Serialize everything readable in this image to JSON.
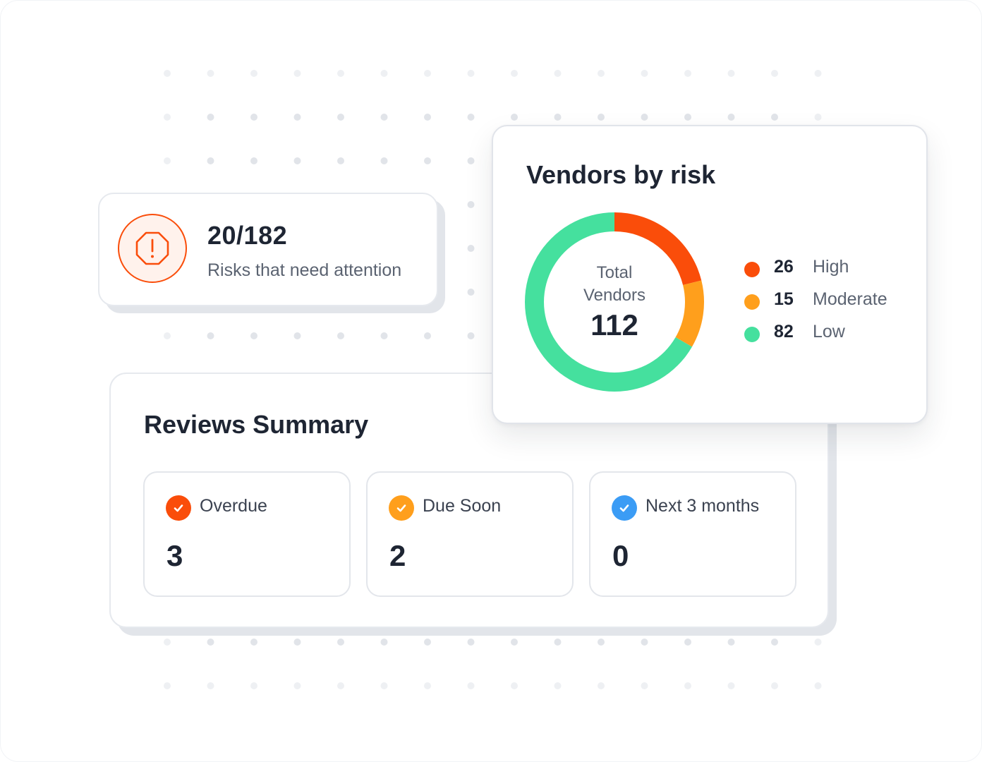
{
  "risk_summary": {
    "count": "20/182",
    "label": "Risks that need attention",
    "icon": "octagon-alert-icon",
    "color": "#FA4D0A"
  },
  "reviews_summary": {
    "title": "Reviews Summary",
    "tiles": [
      {
        "label": "Overdue",
        "value": "3",
        "icon": "check-circle-icon",
        "color": "#FA4D0A"
      },
      {
        "label": "Due Soon",
        "value": "2",
        "icon": "check-circle-icon",
        "color": "#FF9F1C"
      },
      {
        "label": "Next 3 months",
        "value": "0",
        "icon": "check-circle-icon",
        "color": "#3B9CF5"
      }
    ]
  },
  "vendors_by_risk": {
    "title": "Vendors by risk",
    "total_caption": "Total Vendors",
    "total": "112",
    "legend": [
      {
        "value": "26",
        "name": "High",
        "color": "#FA4D0A"
      },
      {
        "value": "15",
        "name": "Moderate",
        "color": "#FF9F1C"
      },
      {
        "value": "82",
        "name": "Low",
        "color": "#45E09E"
      }
    ]
  },
  "chart_data": {
    "type": "pie",
    "categories": [
      "High",
      "Moderate",
      "Low"
    ],
    "values": [
      26,
      15,
      82
    ],
    "colors": [
      "#FA4D0A",
      "#FF9F1C",
      "#45E09E"
    ],
    "title": "Vendors by risk",
    "center_label": "Total Vendors",
    "center_value": "112",
    "legend_position": "right"
  }
}
